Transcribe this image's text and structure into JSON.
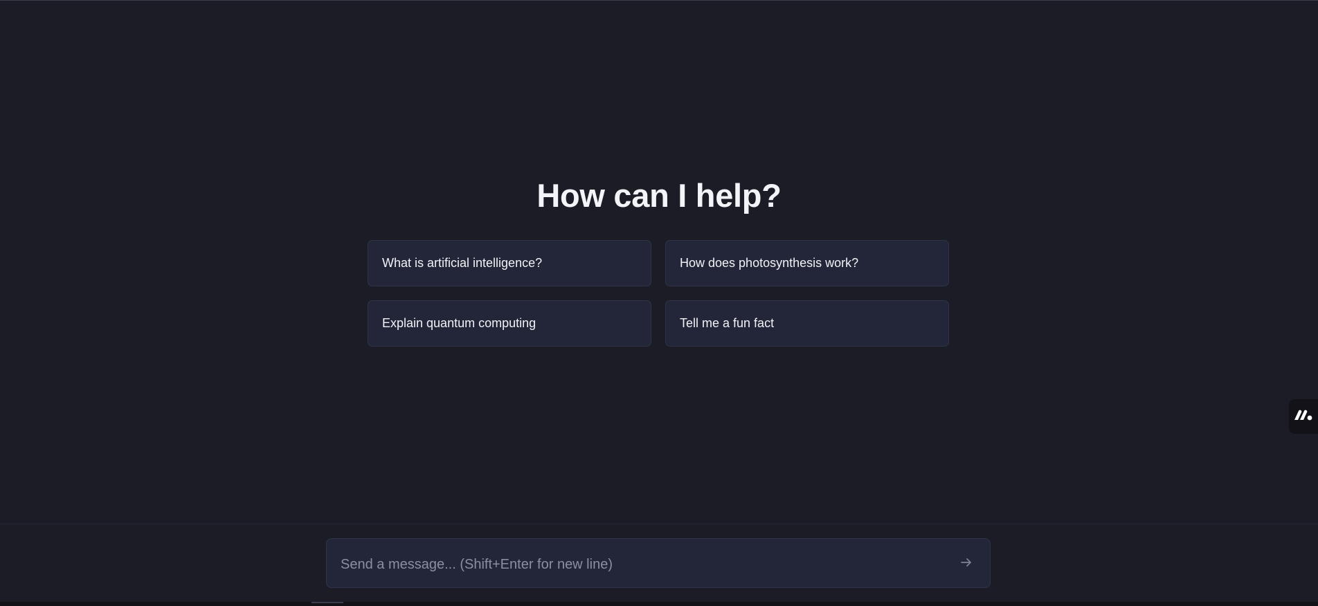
{
  "heading": "How can I help?",
  "suggestions": [
    {
      "label": "What is artificial intelligence?"
    },
    {
      "label": "How does photosynthesis work?"
    },
    {
      "label": "Explain quantum computing"
    },
    {
      "label": "Tell me a fun fact"
    }
  ],
  "composer": {
    "value": "",
    "placeholder": "Send a message... (Shift+Enter for new line)",
    "send_icon": "arrow-right-icon"
  },
  "side_widget": {
    "icon": "brand-logo-icon"
  },
  "colors": {
    "background": "#1c1c27",
    "card": "#232639",
    "card_border": "#303449",
    "text": "#f1f3f7",
    "placeholder": "#8a8fa3"
  }
}
